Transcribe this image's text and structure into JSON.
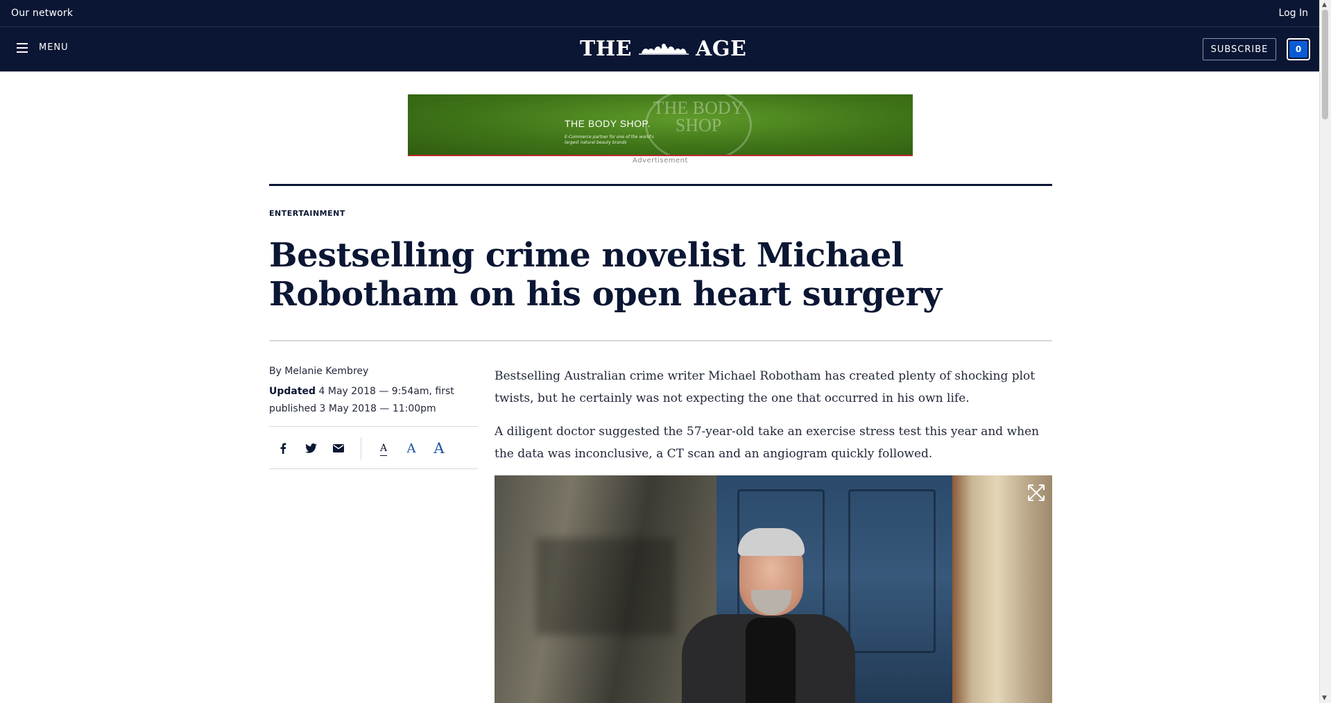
{
  "network_bar": {
    "left_label": "Our network",
    "login_label": "Log In"
  },
  "header": {
    "menu_label": "MENU",
    "logo_left": "THE",
    "logo_right": "AGE",
    "subscribe_label": "SUBSCRIBE",
    "notification_count": "0"
  },
  "ad": {
    "brand": "THE BODY SHOP.",
    "tagline": "E-Commerce partner for one of the world's largest natural beauty brands",
    "circle_text": "THE BODY SHOP",
    "label": "Advertisement"
  },
  "article": {
    "section": "ENTERTAINMENT",
    "headline": "Bestselling crime novelist Michael Robotham on his open heart surgery",
    "byline": "By Melanie Kembrey",
    "updated_label": "Updated",
    "updated_text": " 4 May 2018 — 9:54am, first published 3 May 2018 — 11:00pm",
    "paragraphs": [
      "Bestselling Australian crime writer Michael Robotham has created plenty of shocking plot twists, but he certainly was not expecting the one that occurred in his own life.",
      "A diligent doctor suggested the 57-year-old take an exercise stress test this year and when the data was inconclusive, a CT scan and an angiogram quickly followed."
    ],
    "font_size_glyph": "A"
  },
  "colors": {
    "navy": "#0a1633",
    "accent_blue": "#1c4fa3",
    "ad_green": "#3f7418"
  },
  "icons": [
    "menu-icon",
    "facebook-icon",
    "twitter-icon",
    "email-icon",
    "expand-icon"
  ]
}
